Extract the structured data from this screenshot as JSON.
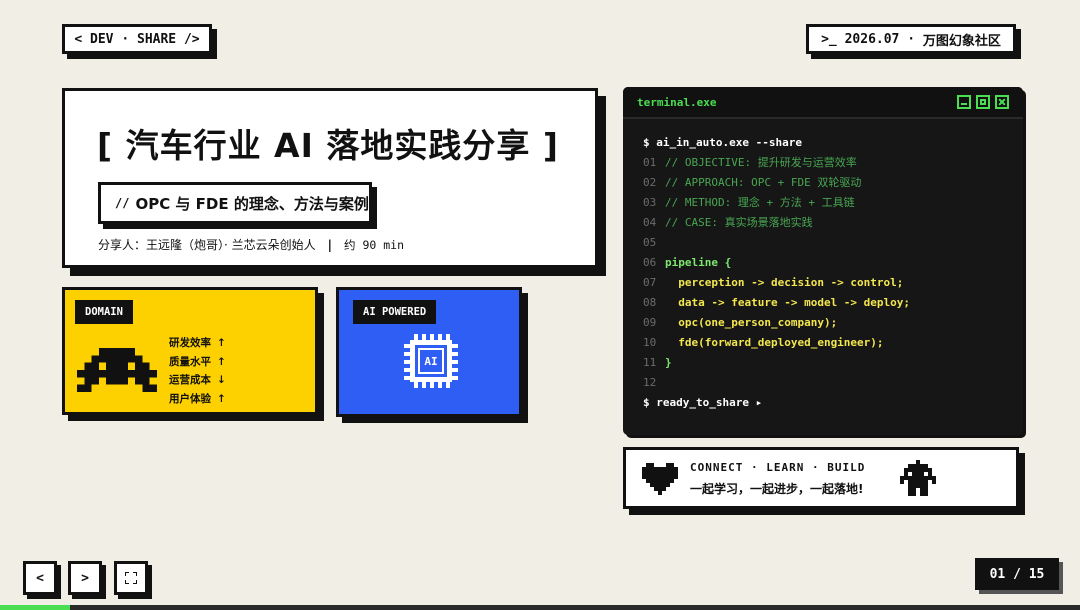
{
  "header": {
    "left_tag": "< DEV · SHARE />",
    "right_tag_prefix": ">_ 2026.07 · ",
    "right_tag_org": "万图幻象社区"
  },
  "title_card": {
    "title": "[ 汽车行业 AI 落地实践分享 ]",
    "subtitle_prefix": "//",
    "subtitle": "OPC 与 FDE 的理念、方法与案例",
    "speaker": "分享人：王远隆（炮哥）· 兰芯云朵创始人",
    "separator": "|",
    "duration": "约 90 min"
  },
  "domain_card": {
    "label": "DOMAIN",
    "icon": "space-invader-icon",
    "color": "#fdd100",
    "metrics": [
      {
        "name": "研发效率",
        "arrow": "↑"
      },
      {
        "name": "质量水平",
        "arrow": "↑"
      },
      {
        "name": "运营成本",
        "arrow": "↓"
      },
      {
        "name": "用户体验",
        "arrow": "↑"
      }
    ]
  },
  "ai_card": {
    "label": "AI POWERED",
    "chip_text": "AI",
    "icon": "ai-chip-icon",
    "color": "#2f5ef4"
  },
  "terminal": {
    "title": "terminal.exe",
    "command": "$ ai_in_auto.exe --share",
    "lines": [
      {
        "n": "01",
        "text": "// OBJECTIVE: 提升研发与运营效率",
        "kind": "comment"
      },
      {
        "n": "02",
        "text": "// APPROACH: OPC + FDE 双轮驱动",
        "kind": "comment"
      },
      {
        "n": "03",
        "text": "// METHOD: 理念 + 方法 + 工具链",
        "kind": "comment"
      },
      {
        "n": "04",
        "text": "// CASE: 真实场景落地实践",
        "kind": "comment"
      },
      {
        "n": "05",
        "text": "",
        "kind": "blank"
      },
      {
        "n": "06",
        "text": "pipeline {",
        "kind": "kw"
      },
      {
        "n": "07",
        "text": "  perception -> decision -> control;",
        "kind": "code"
      },
      {
        "n": "08",
        "text": "  data -> feature -> model -> deploy;",
        "kind": "code"
      },
      {
        "n": "09",
        "text": "  opc(one_person_company);",
        "kind": "code"
      },
      {
        "n": "10",
        "text": "  fde(forward_deployed_engineer);",
        "kind": "code"
      },
      {
        "n": "11",
        "text": "}",
        "kind": "kw"
      },
      {
        "n": "12",
        "text": "",
        "kind": "blank"
      }
    ],
    "footer_command": "$ ready_to_share ▸",
    "accent_color": "#4ade50"
  },
  "connect_card": {
    "en": "CONNECT · LEARN · BUILD",
    "cn": "一起学习，一起进步，一起落地!",
    "left_icon": "pixel-heart-icon",
    "right_icon": "pixel-robot-icon"
  },
  "nav": {
    "prev": "<",
    "next": ">",
    "fullscreen_icon": "fullscreen-icon"
  },
  "pagination": {
    "text": "01 / 15",
    "current": 1,
    "total": 15,
    "progress_fraction": 0.065
  }
}
